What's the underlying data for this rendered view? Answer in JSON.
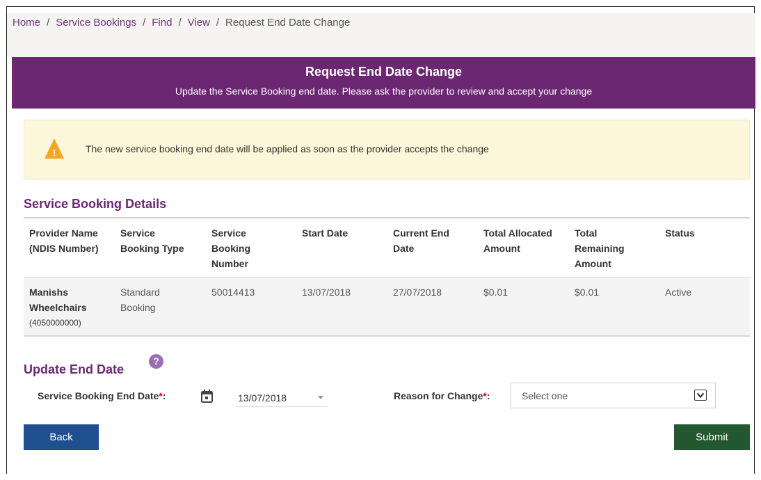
{
  "breadcrumb": {
    "items": [
      "Home",
      "Service Bookings",
      "Find",
      "View",
      "Request End Date Change"
    ],
    "separator": "/"
  },
  "banner": {
    "title": "Request End Date Change",
    "subtitle": "Update the Service Booking end date. Please ask the provider to review and accept your change"
  },
  "alert": {
    "icon": "warning-icon",
    "icon_glyph": "!",
    "text": "The new service booking end date will be applied as soon as the provider accepts the change"
  },
  "details": {
    "title": "Service Booking Details",
    "columns": [
      [
        "Provider Name",
        "(NDIS Number)"
      ],
      [
        "Service",
        "Booking Type"
      ],
      [
        "Service",
        "Booking",
        "Number"
      ],
      [
        "Start Date"
      ],
      [
        "Current End",
        "Date"
      ],
      [
        "Total Allocated",
        "Amount"
      ],
      [
        "Total",
        "Remaining",
        "Amount"
      ],
      [
        "Status"
      ]
    ],
    "row": {
      "provider_line1": "Manishs",
      "provider_line2": "Wheelchairs",
      "ndis_number": "(4050000000)",
      "type_line1": "Standard",
      "type_line2": "Booking",
      "booking_number": "50014413",
      "start_date": "13/07/2018",
      "current_end_date": "27/07/2018",
      "total_allocated": "$0.01",
      "total_remaining": "$0.01",
      "status": "Active"
    }
  },
  "update": {
    "title": "Update End Date",
    "help_glyph": "?",
    "end_date_label": "Service Booking End Date",
    "end_date_value": "13/07/2018",
    "reason_label": "Reason for Change",
    "reason_placeholder": "Select one",
    "required_marker": "*",
    "label_suffix": ":"
  },
  "actions": {
    "back_label": "Back",
    "submit_label": "Submit"
  },
  "colors": {
    "brand_purple": "#6b2772",
    "back_button": "#1f4f8f",
    "submit_button": "#22572f",
    "alert_bg": "#fcf6da",
    "warning_orange": "#f5a623",
    "required_red": "#d0021b"
  }
}
